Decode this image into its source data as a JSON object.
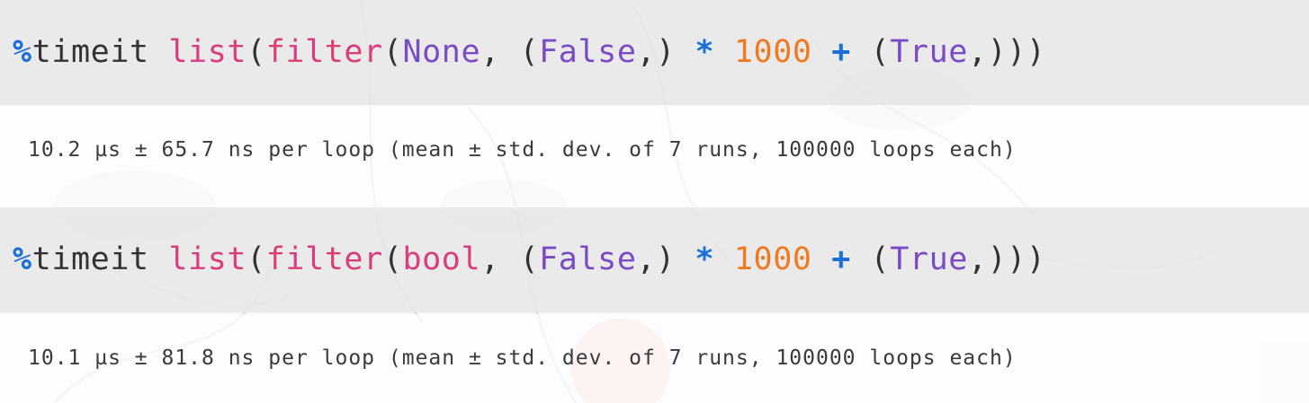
{
  "colors": {
    "magic": "#1a6fd8",
    "builtin": "#d93d7a",
    "constant": "#7a4bc4",
    "number": "#f07a22",
    "operator": "#1a6fd8",
    "punctuation": "#333333",
    "code_cell_bg": "#e8e8e8",
    "output_text": "#3a3a3a"
  },
  "cells": [
    {
      "code_tokens": [
        {
          "text": "%",
          "kind": "magic"
        },
        {
          "text": "timeit",
          "kind": "plain"
        },
        {
          "text": " ",
          "kind": "plain"
        },
        {
          "text": "list",
          "kind": "builtin"
        },
        {
          "text": "(",
          "kind": "plain"
        },
        {
          "text": "filter",
          "kind": "builtin"
        },
        {
          "text": "(",
          "kind": "plain"
        },
        {
          "text": "None",
          "kind": "constant"
        },
        {
          "text": ", (",
          "kind": "plain"
        },
        {
          "text": "False",
          "kind": "constant"
        },
        {
          "text": ",) ",
          "kind": "plain"
        },
        {
          "text": "*",
          "kind": "operator"
        },
        {
          "text": " ",
          "kind": "plain"
        },
        {
          "text": "1000",
          "kind": "number"
        },
        {
          "text": " ",
          "kind": "plain"
        },
        {
          "text": "+",
          "kind": "operator"
        },
        {
          "text": " (",
          "kind": "plain"
        },
        {
          "text": "True",
          "kind": "constant"
        },
        {
          "text": ",)))",
          "kind": "plain"
        }
      ],
      "output": "10.2 µs ± 65.7 ns per loop (mean ± std. dev. of 7 runs, 100000 loops each)"
    },
    {
      "code_tokens": [
        {
          "text": "%",
          "kind": "magic"
        },
        {
          "text": "timeit",
          "kind": "plain"
        },
        {
          "text": " ",
          "kind": "plain"
        },
        {
          "text": "list",
          "kind": "builtin"
        },
        {
          "text": "(",
          "kind": "plain"
        },
        {
          "text": "filter",
          "kind": "builtin"
        },
        {
          "text": "(",
          "kind": "plain"
        },
        {
          "text": "bool",
          "kind": "builtin"
        },
        {
          "text": ", (",
          "kind": "plain"
        },
        {
          "text": "False",
          "kind": "constant"
        },
        {
          "text": ",) ",
          "kind": "plain"
        },
        {
          "text": "*",
          "kind": "operator"
        },
        {
          "text": " ",
          "kind": "plain"
        },
        {
          "text": "1000",
          "kind": "number"
        },
        {
          "text": " ",
          "kind": "plain"
        },
        {
          "text": "+",
          "kind": "operator"
        },
        {
          "text": " (",
          "kind": "plain"
        },
        {
          "text": "True",
          "kind": "constant"
        },
        {
          "text": ",)))",
          "kind": "plain"
        }
      ],
      "output": "10.1 µs ± 81.8 ns per loop (mean ± std. dev. of 7 runs, 100000 loops each)"
    }
  ]
}
